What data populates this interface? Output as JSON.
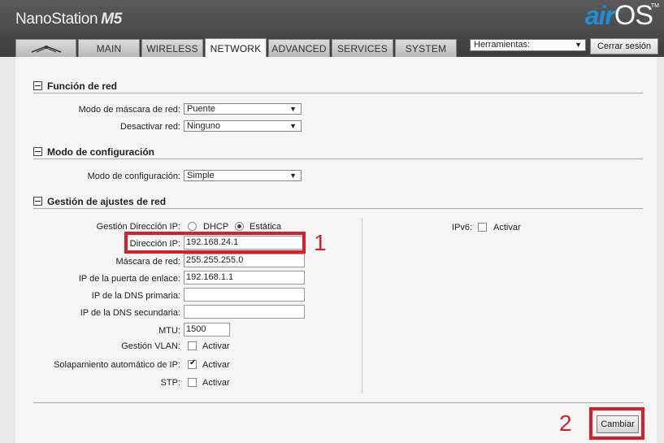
{
  "header": {
    "product_name": "NanoStation",
    "product_model": "M5",
    "logo_air": "air",
    "logo_os": "OS",
    "logo_tm": "TM"
  },
  "tabs": [
    {
      "label": "MAIN"
    },
    {
      "label": "WIRELESS"
    },
    {
      "label": "NETWORK",
      "active": true
    },
    {
      "label": "ADVANCED"
    },
    {
      "label": "SERVICES"
    },
    {
      "label": "SYSTEM"
    }
  ],
  "toolbar": {
    "tools_value": "Herramientas:",
    "logout_label": "Cerrar sesión"
  },
  "network_role": {
    "title": "Función de red",
    "mask_mode_label": "Modo de máscara de red:",
    "mask_mode_value": "Puente",
    "disable_network_label": "Desactivar red:",
    "disable_network_value": "Ninguno"
  },
  "config_mode": {
    "title": "Modo de configuración",
    "mode_label": "Modo de configuración:",
    "mode_value": "Simple"
  },
  "network_settings": {
    "title": "Gestión de ajustes de red",
    "ip_mgmt_label": "Gestión Dirección IP:",
    "dhcp_label": "DHCP",
    "static_label": "Estática",
    "ip_label": "Dirección IP:",
    "ip_value": "192.168.24.1",
    "mask_label": "Máscara de red:",
    "mask_value": "255.255.255.0",
    "gateway_label": "IP de la puerta de enlace:",
    "gateway_value": "192.168.1.1",
    "dns1_label": "IP de la DNS primaria:",
    "dns1_value": "",
    "dns2_label": "IP de la DNS secundaria:",
    "dns2_value": "",
    "mtu_label": "MTU:",
    "mtu_value": "1500",
    "vlan_label": "Gestión VLAN:",
    "vlan_enable": "Activar",
    "alias_label": "Solapamiento automático de IP:",
    "alias_enable": "Activar",
    "stp_label": "STP:",
    "stp_enable": "Activar",
    "ipv6_label": "IPv6:",
    "ipv6_enable": "Activar"
  },
  "annotations": {
    "step1": "1",
    "step2": "2"
  },
  "actions": {
    "change_label": "Cambiar"
  },
  "colors": {
    "annotation": "#d61f26",
    "logo_accent": "#1e8fd6"
  }
}
